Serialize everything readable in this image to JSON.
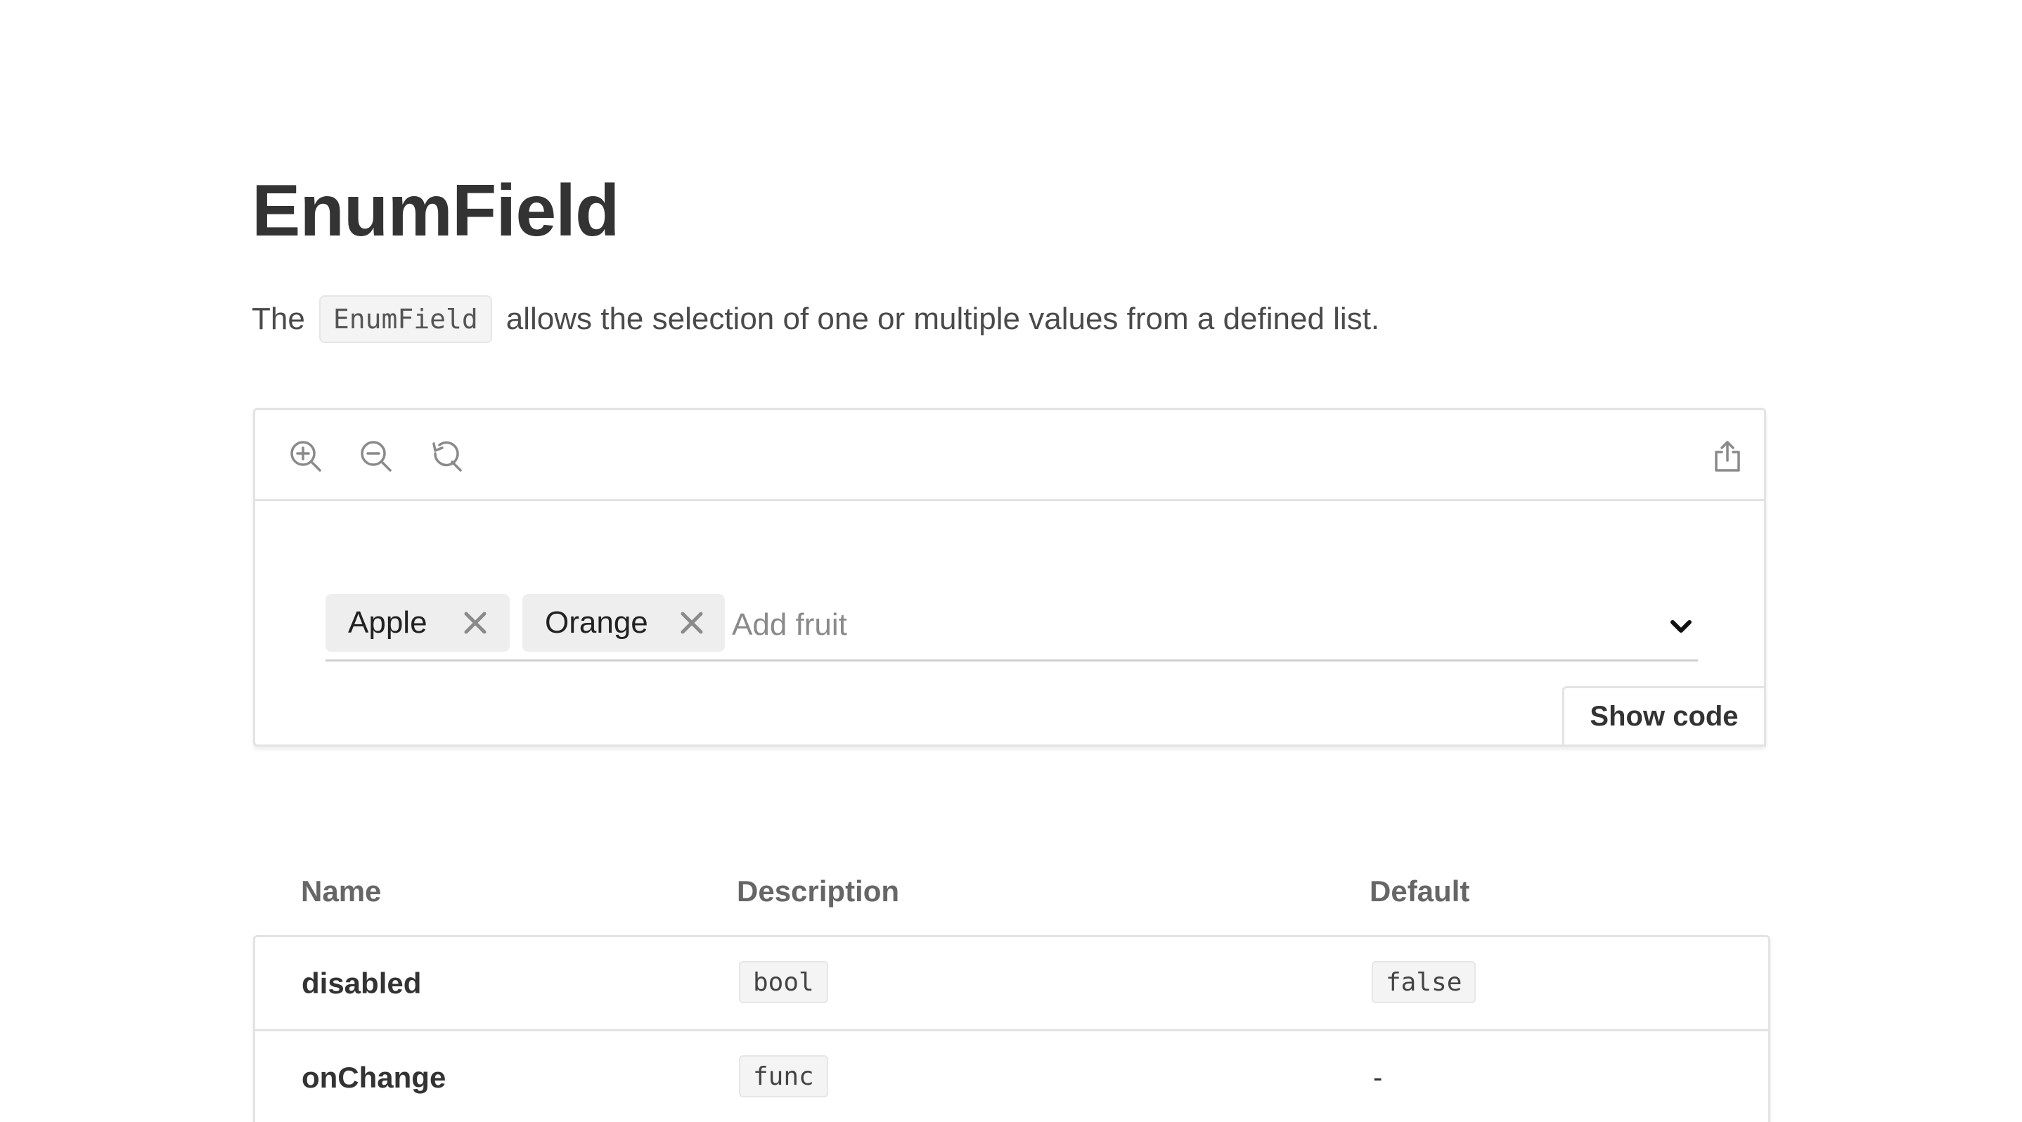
{
  "page": {
    "title": "EnumField",
    "intro": {
      "before": "The",
      "code": "EnumField",
      "after": "allows the selection of one or multiple values from a defined list."
    }
  },
  "playground": {
    "toolbar": {
      "icons": [
        "zoom-in-icon",
        "zoom-out-icon",
        "reset-zoom-icon",
        "share-icon"
      ]
    },
    "field": {
      "chips": [
        {
          "label": "Apple"
        },
        {
          "label": "Orange"
        }
      ],
      "placeholder": "Add fruit",
      "value": ""
    },
    "show_code_label": "Show code"
  },
  "props_table": {
    "headers": {
      "name": "Name",
      "description": "Description",
      "default": "Default"
    },
    "rows": [
      {
        "name": "disabled",
        "description": "bool",
        "default": "false"
      },
      {
        "name": "onChange",
        "description": "func",
        "default": "-"
      }
    ]
  },
  "colors": {
    "text": "#333333",
    "muted": "#666666",
    "border": "#e3e3e3",
    "chip_bg": "#eeeeee",
    "code_bg": "#f4f4f4"
  }
}
